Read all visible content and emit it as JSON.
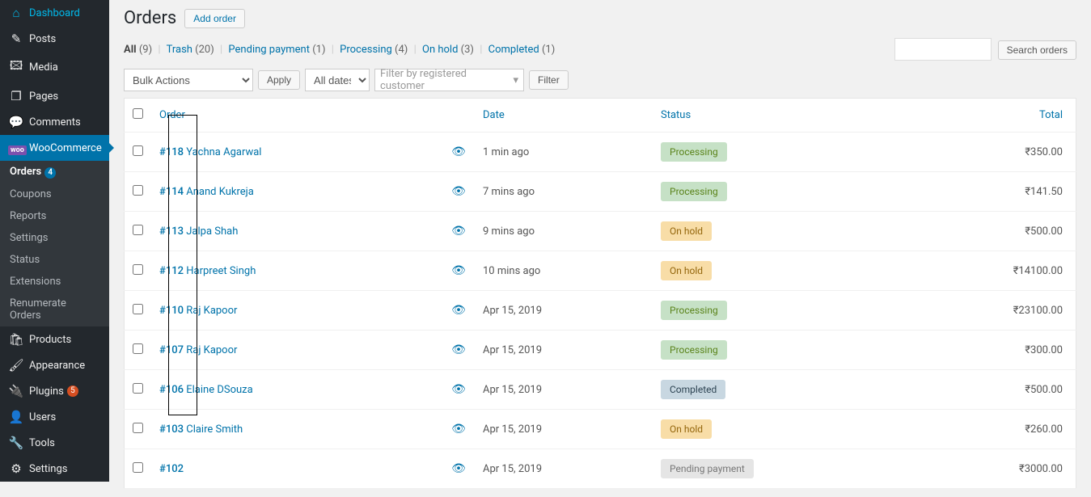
{
  "sidebar": {
    "items": [
      {
        "icon": "⌂",
        "label": "Dashboard"
      },
      {
        "icon": "✎",
        "label": "Posts"
      },
      {
        "icon": "🖾",
        "label": "Media"
      },
      {
        "icon": "❐",
        "label": "Pages"
      },
      {
        "icon": "💬",
        "label": "Comments"
      },
      {
        "icon": "woo",
        "label": "WooCommerce",
        "active": true
      },
      {
        "icon": "🛍",
        "label": "Products"
      },
      {
        "icon": "🖌",
        "label": "Appearance"
      },
      {
        "icon": "🔌",
        "label": "Plugins",
        "badge": "5"
      },
      {
        "icon": "👤",
        "label": "Users"
      },
      {
        "icon": "🔧",
        "label": "Tools"
      },
      {
        "icon": "⚙",
        "label": "Settings"
      }
    ],
    "woo_sub": [
      {
        "label": "Orders",
        "active": true,
        "badge": "4"
      },
      {
        "label": "Coupons"
      },
      {
        "label": "Reports"
      },
      {
        "label": "Settings"
      },
      {
        "label": "Status"
      },
      {
        "label": "Extensions"
      },
      {
        "label": "Renumerate Orders"
      }
    ]
  },
  "header": {
    "title": "Orders",
    "add_label": "Add order"
  },
  "status_filters": {
    "all_label": "All",
    "all_count": "(9)",
    "trash_label": "Trash",
    "trash_count": "(20)",
    "pending_label": "Pending payment",
    "pending_count": "(1)",
    "processing_label": "Processing",
    "processing_count": "(4)",
    "onhold_label": "On hold",
    "onhold_count": "(3)",
    "completed_label": "Completed",
    "completed_count": "(1)"
  },
  "search": {
    "button": "Search orders"
  },
  "tablenav": {
    "bulk_label": "Bulk Actions",
    "apply_label": "Apply",
    "dates_label": "All dates",
    "filter_customer_label": "Filter by registered customer",
    "filter_label": "Filter"
  },
  "table": {
    "headers": {
      "order": "Order",
      "date": "Date",
      "status": "Status",
      "total": "Total"
    },
    "rows": [
      {
        "id": "#118",
        "customer": "Yachna Agarwal",
        "date": "1 min ago",
        "status": "Processing",
        "status_class": "processing",
        "total": "₹350.00"
      },
      {
        "id": "#114",
        "customer": "Anand Kukreja",
        "date": "7 mins ago",
        "status": "Processing",
        "status_class": "processing",
        "total": "₹141.50"
      },
      {
        "id": "#113",
        "customer": "Jalpa Shah",
        "date": "9 mins ago",
        "status": "On hold",
        "status_class": "onhold",
        "total": "₹500.00"
      },
      {
        "id": "#112",
        "customer": "Harpreet Singh",
        "date": "10 mins ago",
        "status": "On hold",
        "status_class": "onhold",
        "total": "₹14100.00"
      },
      {
        "id": "#110",
        "customer": "Raj Kapoor",
        "date": "Apr 15, 2019",
        "status": "Processing",
        "status_class": "processing",
        "total": "₹23100.00"
      },
      {
        "id": "#107",
        "customer": "Raj Kapoor",
        "date": "Apr 15, 2019",
        "status": "Processing",
        "status_class": "processing",
        "total": "₹300.00"
      },
      {
        "id": "#106",
        "customer": "Elaine DSouza",
        "date": "Apr 15, 2019",
        "status": "Completed",
        "status_class": "completed",
        "total": "₹500.00"
      },
      {
        "id": "#103",
        "customer": "Claire Smith",
        "date": "Apr 15, 2019",
        "status": "On hold",
        "status_class": "onhold",
        "total": "₹260.00"
      },
      {
        "id": "#102",
        "customer": "",
        "date": "Apr 15, 2019",
        "status": "Pending payment",
        "status_class": "pending",
        "total": "₹3000.00"
      }
    ]
  }
}
